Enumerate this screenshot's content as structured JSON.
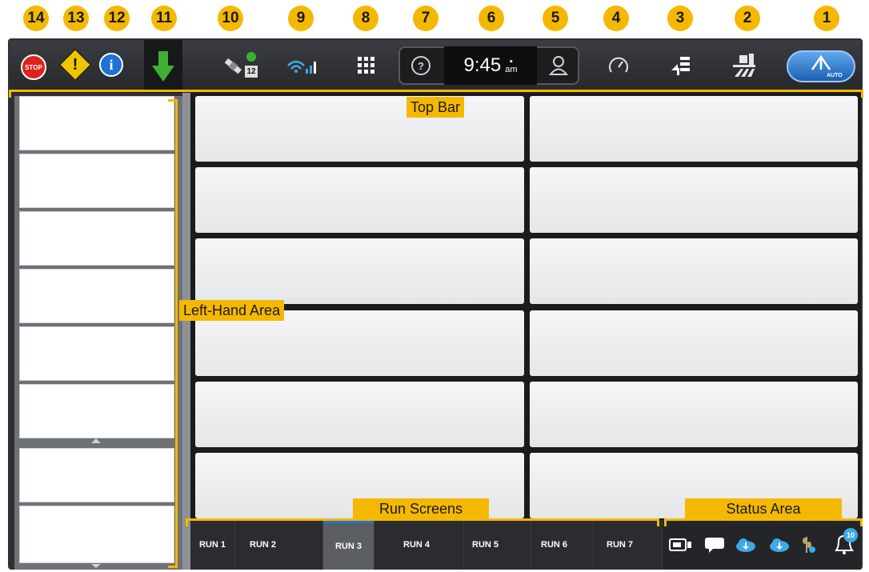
{
  "callouts": [
    "14",
    "13",
    "12",
    "11",
    "10",
    "9",
    "8",
    "7",
    "6",
    "5",
    "4",
    "3",
    "2",
    "1"
  ],
  "topbar": {
    "stop_text": "STOP",
    "warning_mark": "!",
    "info_mark": "i",
    "gps_count": "12",
    "clock": {
      "time": "9:45",
      "period": "am"
    },
    "help_mark": "?",
    "auto_label": "AUTO"
  },
  "labels": {
    "top_bar": "Top Bar",
    "left_hand_area": "Left-Hand Area",
    "run_screens": "Run Screens",
    "status_area": "Status Area"
  },
  "run_tabs": [
    "RUN 1",
    "RUN 2",
    "RUN 3",
    "RUN 4",
    "RUN 5",
    "RUN 6",
    "RUN 7"
  ],
  "active_run_tab": "RUN 3",
  "status": {
    "notification_count": "10"
  },
  "colors": {
    "callout": "#f5b800",
    "accent_blue": "#1d73d6",
    "stop_red": "#d9251c",
    "arrow_green": "#3cb034"
  }
}
